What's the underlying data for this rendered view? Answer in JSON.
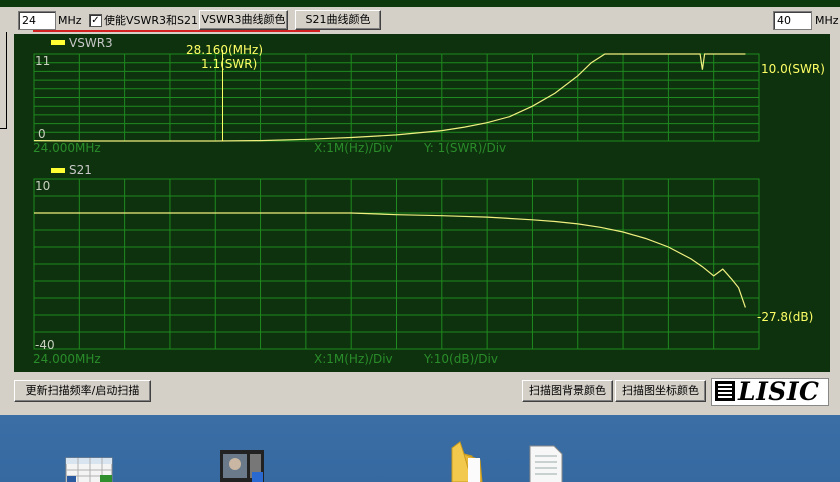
{
  "toolbar": {
    "start_freq": "24",
    "start_unit": "MHz",
    "enable_checked": "✓",
    "enable_label": "使能VSWR3和S21",
    "vswr_color_button": "VSWR3曲线颜色",
    "s21_color_button": "S21曲线颜色",
    "stop_freq": "40",
    "stop_unit": "MHz"
  },
  "top_chart_ghost": {
    "left": "...",
    "right": "..."
  },
  "chart_data": [
    {
      "type": "line",
      "legend": "VSWR3",
      "ylim": [
        1,
        11
      ],
      "y_top_label": "11",
      "y_bottom_label": "0",
      "x_start_label": "24.000MHz",
      "x_div_label": "X:1M(Hz)/Div",
      "y_div_label": "Y: 1(SWR)/Div",
      "xlim": [
        24,
        40
      ],
      "x": [
        24,
        25,
        26,
        27,
        28,
        29,
        30,
        31,
        32,
        33,
        33.5,
        34,
        34.5,
        35,
        35.5,
        36,
        36.3,
        36.6,
        37,
        38,
        38.7,
        38.75,
        38.8,
        39,
        39.7
      ],
      "y": [
        1.05,
        1.0,
        1.0,
        1.0,
        1.0,
        1.05,
        1.2,
        1.4,
        1.7,
        2.2,
        2.6,
        3.1,
        3.8,
        5.0,
        6.5,
        8.5,
        10.0,
        11,
        11,
        11,
        11,
        9.2,
        11,
        11,
        11
      ],
      "marker": {
        "x": 28.16,
        "freq_label": "28.160(MHz)",
        "value_label": "1.1(SWR)"
      },
      "end_readout": "10.0(SWR)"
    },
    {
      "type": "line",
      "legend": "S21",
      "ylim": [
        -40,
        10
      ],
      "y_top_label": "10",
      "y_bottom_label": "-40",
      "x_start_label": "24.000MHz",
      "x_div_label": "X:1M(Hz)/Div",
      "y_div_label": "Y:10(dB)/Div",
      "xlim": [
        24,
        40
      ],
      "x": [
        24,
        25,
        26,
        27,
        28,
        29,
        30,
        31,
        32,
        33,
        34,
        35,
        35.5,
        36,
        36.5,
        37,
        37.5,
        38,
        38.5,
        38.75,
        39,
        39.2,
        39.4,
        39.55,
        39.7
      ],
      "y": [
        0,
        0,
        0,
        0,
        0,
        0,
        0,
        0,
        -0.5,
        -0.8,
        -1.2,
        -2.0,
        -2.5,
        -3.2,
        -4.2,
        -5.6,
        -7.5,
        -10.0,
        -13.5,
        -15.8,
        -18.5,
        -16.5,
        -19.5,
        -22.0,
        -27.8
      ],
      "end_readout": "-27.8(dB)"
    }
  ],
  "bottom": {
    "rescan_button": "更新扫描频率/启动扫描",
    "bg_color_button": "扫描图背景颜色",
    "axis_color_button": "扫描图坐标颜色",
    "logo_text": "LISIC"
  },
  "colors": {
    "scope_bg": "#0d320d",
    "grid": "#1f8a1f",
    "trace": "#f0f080",
    "marker": "#ffff66",
    "desktop": "#3a6ea5"
  },
  "desktop_icons": [
    "spreadsheet-icon",
    "video-file-icon",
    "folder-icon",
    "text-document-icon"
  ]
}
